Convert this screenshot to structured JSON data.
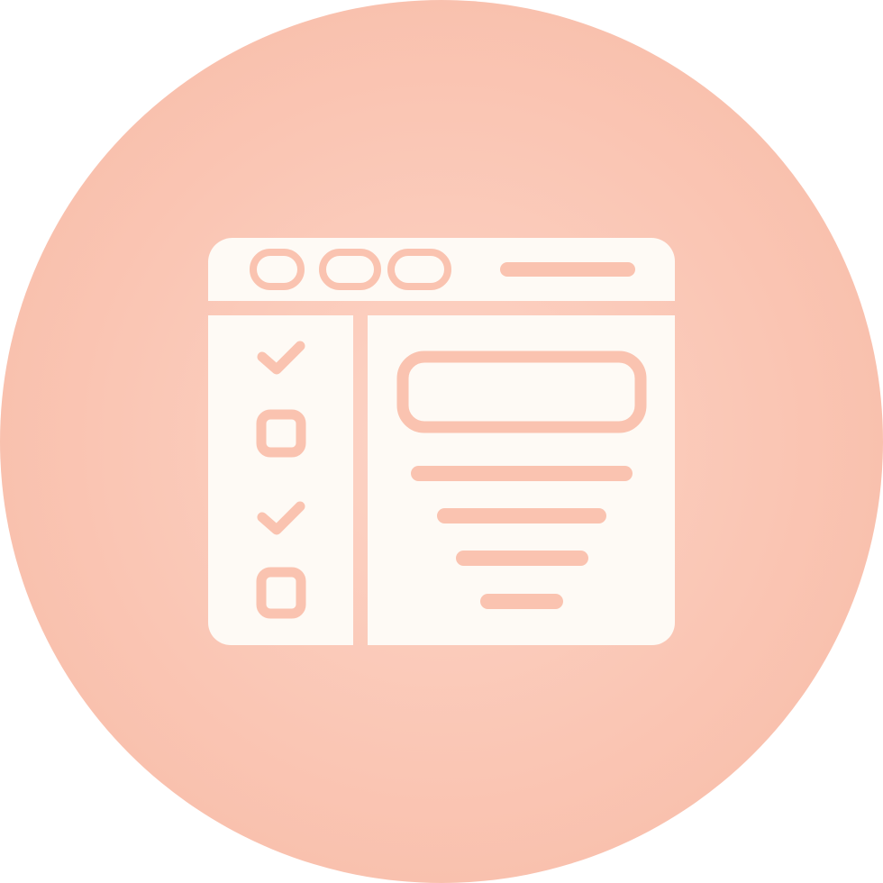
{
  "icon": {
    "name": "browser-checklist-icon",
    "checklist_states": [
      "checked",
      "unchecked",
      "checked",
      "unchecked"
    ]
  },
  "colors": {
    "background_center": "#FDD4C6",
    "background_edge": "#F9C1AE",
    "icon_fill": "#FEFAF5",
    "icon_detail": "#FAC3B0"
  }
}
